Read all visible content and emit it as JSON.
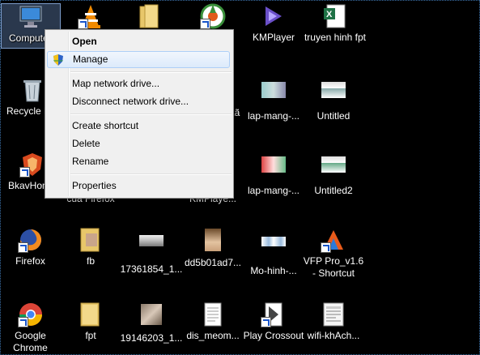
{
  "desktop": {
    "icons": [
      {
        "label": "Computer",
        "icon": "computer-icon"
      },
      {
        "label": "",
        "icon": "vlc-icon"
      },
      {
        "label": "",
        "icon": "folder-icon"
      },
      {
        "label": "",
        "icon": "coccoc-icon"
      },
      {
        "label": "KMPlayer",
        "icon": "kmplayer-icon"
      },
      {
        "label": "truyen hinh fpt",
        "icon": "excel-file-icon"
      },
      {
        "label": "Recycle Bin",
        "icon": "recycle-bin-icon"
      },
      {
        "label": "kã",
        "icon": "partial-icon"
      },
      {
        "label": "lap-mang-...",
        "icon": "image-thumb-icon"
      },
      {
        "label": "Untitled",
        "icon": "image-thumb-icon"
      },
      {
        "label": "BkavHome",
        "icon": "bkav-icon"
      },
      {
        "label": "cua Firefox",
        "icon": "firefox-partial-icon"
      },
      {
        "label": "KMPlaye...",
        "icon": "kmplayer-partial-icon"
      },
      {
        "label": "lap-mang-...",
        "icon": "image-thumb-icon"
      },
      {
        "label": "Untitled2",
        "icon": "image-thumb-icon"
      },
      {
        "label": "Firefox",
        "icon": "firefox-icon"
      },
      {
        "label": "fb",
        "icon": "folder-photo-icon"
      },
      {
        "label": "17361854_1...",
        "icon": "image-thumb-icon"
      },
      {
        "label": "dd5b01ad7...",
        "icon": "image-thumb-icon"
      },
      {
        "label": "Mo-hinh-...",
        "icon": "image-thumb-icon"
      },
      {
        "label": "VFP Pro_v1.6 - Shortcut",
        "icon": "vfp-icon"
      },
      {
        "label": "Google Chrome",
        "icon": "chrome-icon"
      },
      {
        "label": "fpt",
        "icon": "folder-icon"
      },
      {
        "label": "19146203_1...",
        "icon": "image-thumb-icon"
      },
      {
        "label": "dis_meom...",
        "icon": "text-file-icon"
      },
      {
        "label": "Play Crossout",
        "icon": "crossout-icon"
      },
      {
        "label": "wifi-khAch...",
        "icon": "document-icon"
      }
    ]
  },
  "context_menu": {
    "items": [
      {
        "label": "Open"
      },
      {
        "label": "Manage"
      },
      {
        "label": "Map network drive..."
      },
      {
        "label": "Disconnect network drive..."
      },
      {
        "label": "Create shortcut"
      },
      {
        "label": "Delete"
      },
      {
        "label": "Rename"
      },
      {
        "label": "Properties"
      }
    ]
  },
  "colors": {
    "desktop_bg": "#000000",
    "menu_bg": "#f0f0f0",
    "hover_border": "#aecff7"
  }
}
